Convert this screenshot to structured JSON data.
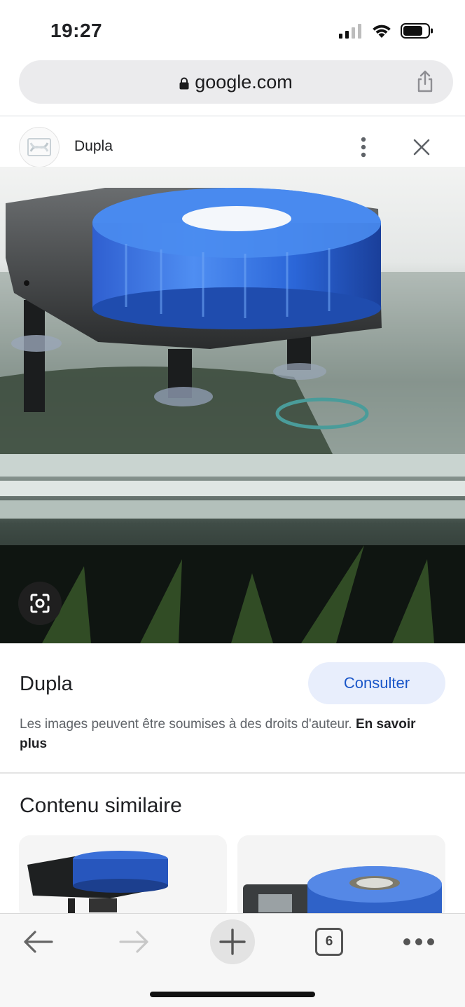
{
  "status_bar": {
    "time": "19:27"
  },
  "address_bar": {
    "url": "google.com"
  },
  "source": {
    "name": "Dupla"
  },
  "image_detail": {
    "title": "Dupla",
    "visit_label": "Consulter",
    "copyright_text": "Les images peuvent être soumises à des droits d'auteur.",
    "learn_more": "En savoir plus"
  },
  "similar": {
    "heading": "Contenu similaire"
  },
  "toolbar": {
    "tab_count": "6"
  }
}
